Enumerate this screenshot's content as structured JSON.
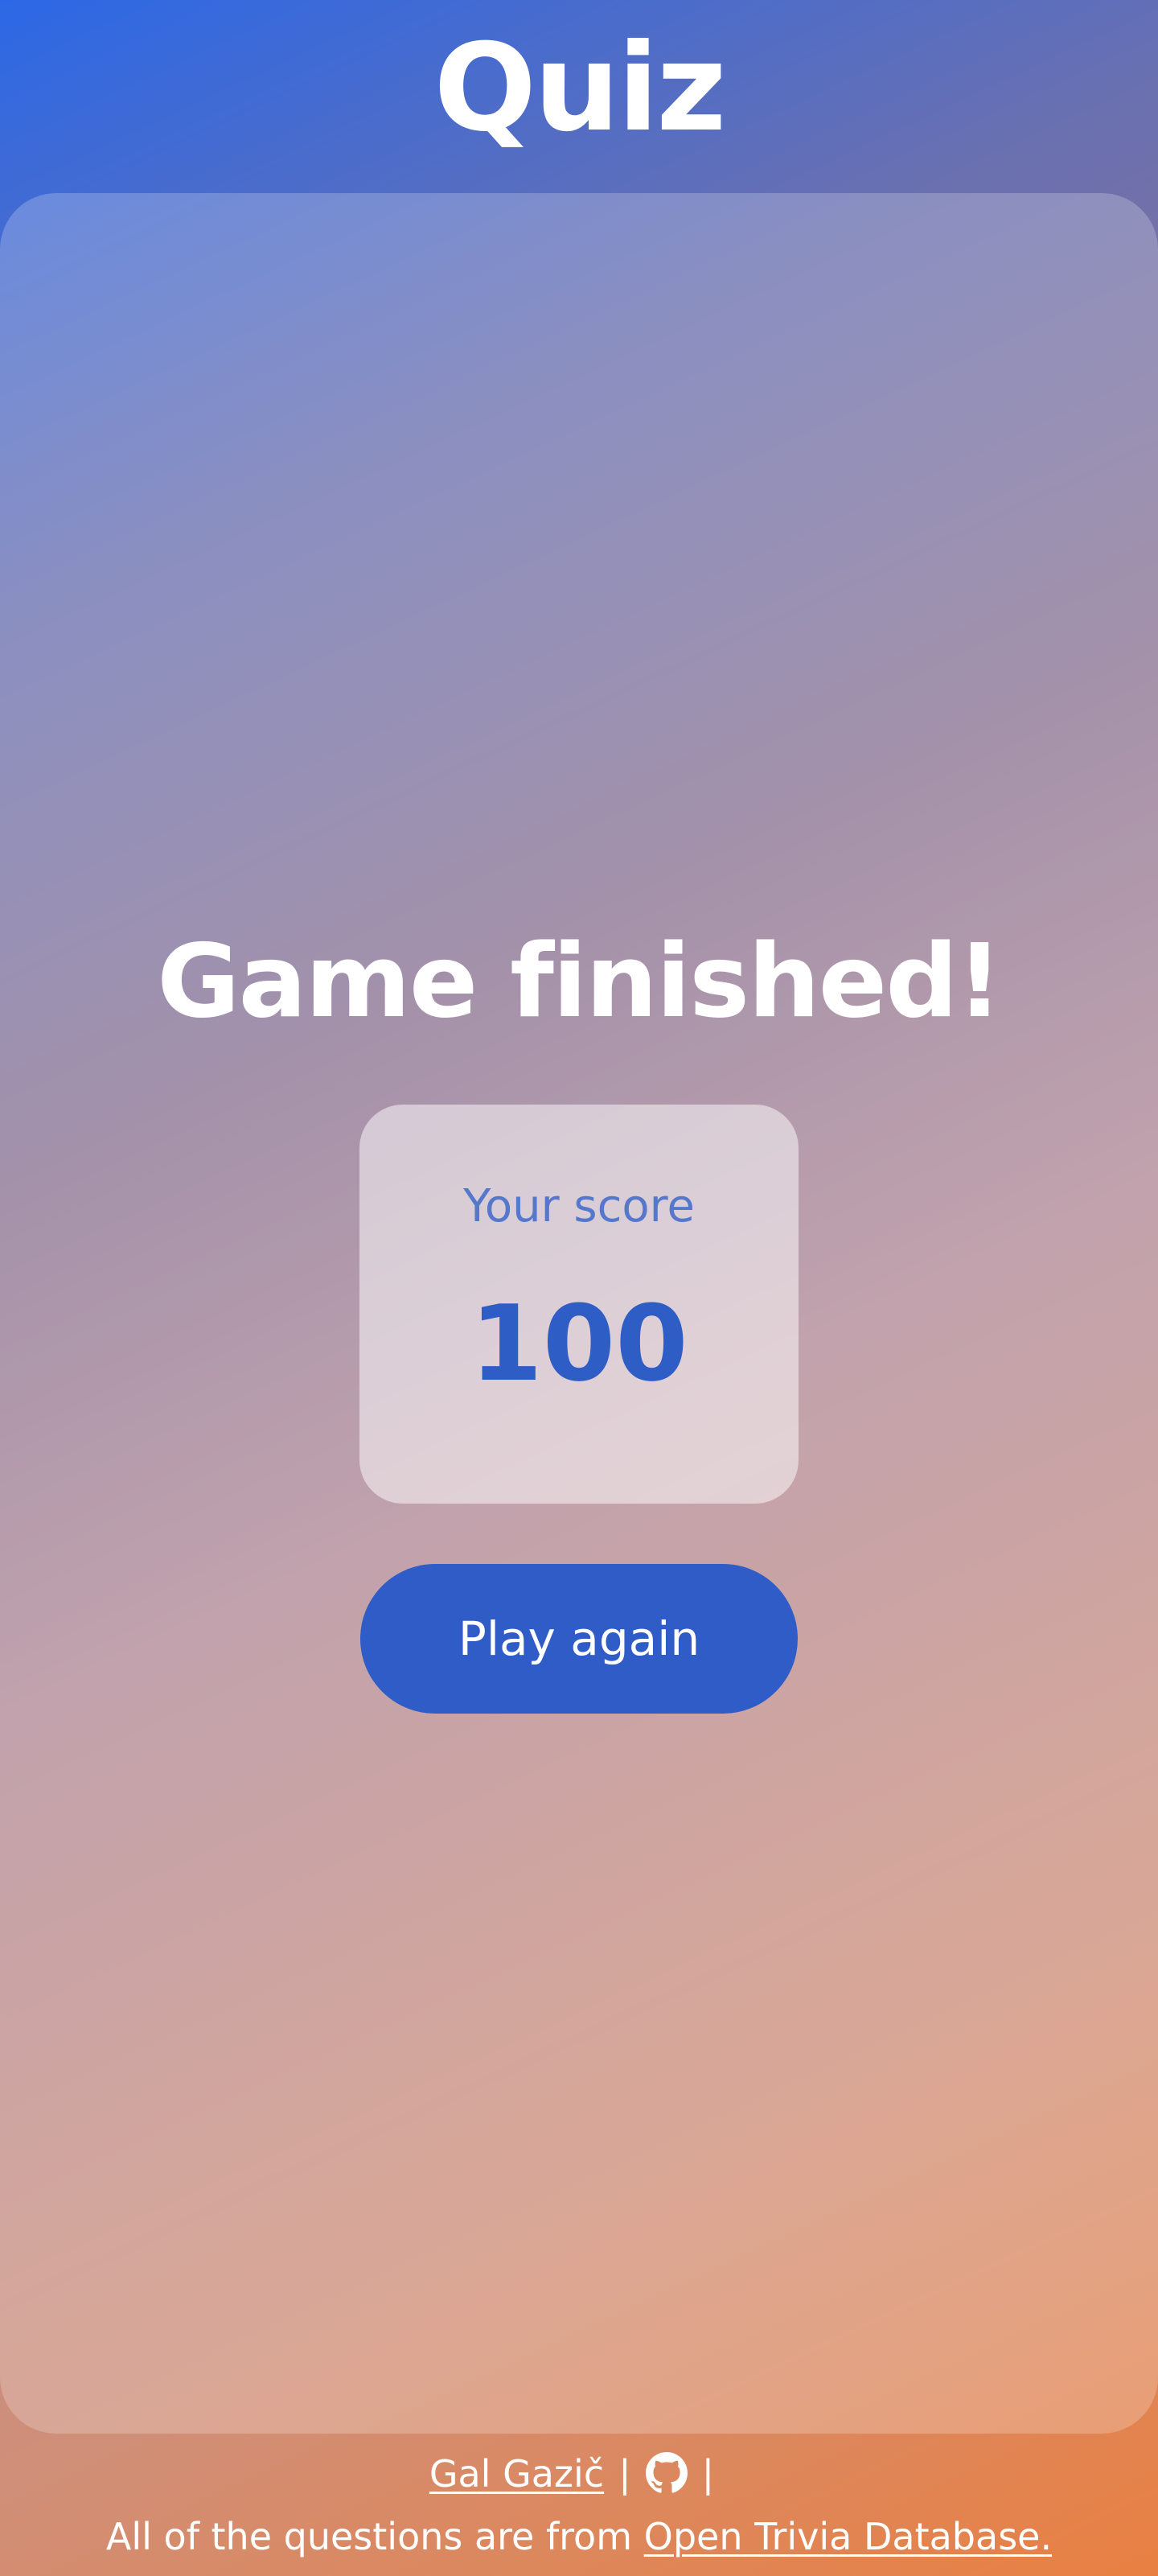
{
  "header": {
    "title": "Quiz"
  },
  "result": {
    "title": "Game finished!",
    "score_label": "Your score",
    "score_value": "100",
    "play_again_label": "Play again"
  },
  "footer": {
    "author": "Gal Gazič",
    "separator": "|",
    "github_icon": "github-icon",
    "source_prefix": "All of the questions are from",
    "source_link": "Open Trivia Database."
  },
  "colors": {
    "accent": "#2f5cc6",
    "gradient_start": "#2c68e6",
    "gradient_end": "#e98042"
  }
}
